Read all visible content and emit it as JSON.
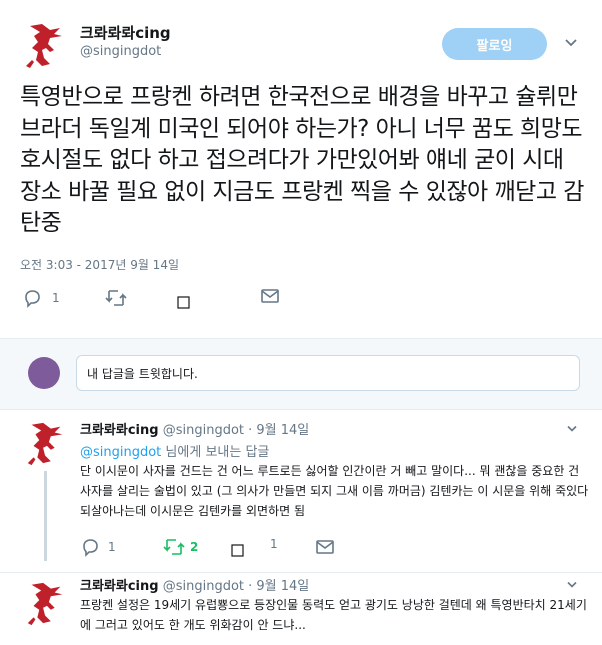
{
  "tweet": {
    "author_name": "크롸롸롸cing",
    "author_handle": "@singingdot",
    "follow_label": "팔로잉",
    "text": "특영반으로 프랑켄 하려면 한국전으로 배경을 바꾸고 슐뤼만 브라더 독일계 미국인 되어야 하는가? 아니 너무 꿈도 희망도 호시절도 없다 하고 접으려다가 가만있어봐 얘네 굳이 시대 장소 바꿀 필요 없이 지금도 프랑켄 찍을 수 있잖아 깨닫고 감탄중",
    "timestamp": "오전 3:03 - 2017년 9월 14일",
    "reply_count": "1"
  },
  "reply_box": {
    "placeholder": "내 답글을 트윗합니다."
  },
  "replies": [
    {
      "name": "크롸롸롸cing",
      "meta": "@singingdot · 9월 14일",
      "replying_to_mention": "@singingdot",
      "replying_to_suffix": " 님에게 보내는 답글",
      "text": "단 이시문이 사자를 건드는 건 어느 루트로든 싫어할 인간이란 거 빼고 말이다... 뭐 괜찮을 중요한 건 사자를 살리는 술법이 있고 (그 의사가 만들면 되지 그새 이름 까머금) 김텐카는 이 시문을 위해 죽있다 되살아나는데 이시문은 김텐카를 외면하면 됨",
      "reply_count": "1",
      "retweet_count": "2",
      "like_count": "1"
    },
    {
      "name": "크롸롸롸cing",
      "meta": "@singingdot · 9월 14일",
      "text": "프랑켄 설정은 19세기 유럽뿅으로 등장인물 동력도 얻고 광기도 낭낭한 걸텐데 왜 특영반타치 21세기에 그러고 있어도 한 개도 위화감이 안 드냐..."
    }
  ],
  "colors": {
    "accent": "#1da1f2",
    "follow_button": "#9fd0f6",
    "retweet_green": "#17bf63",
    "muted": "#657786",
    "avatar_red": "#c0202a",
    "reply_avatar": "#7e5b9b"
  },
  "icons": [
    "dragon-avatar",
    "chevron-down-icon",
    "reply-icon",
    "retweet-icon",
    "like-icon",
    "message-icon"
  ]
}
